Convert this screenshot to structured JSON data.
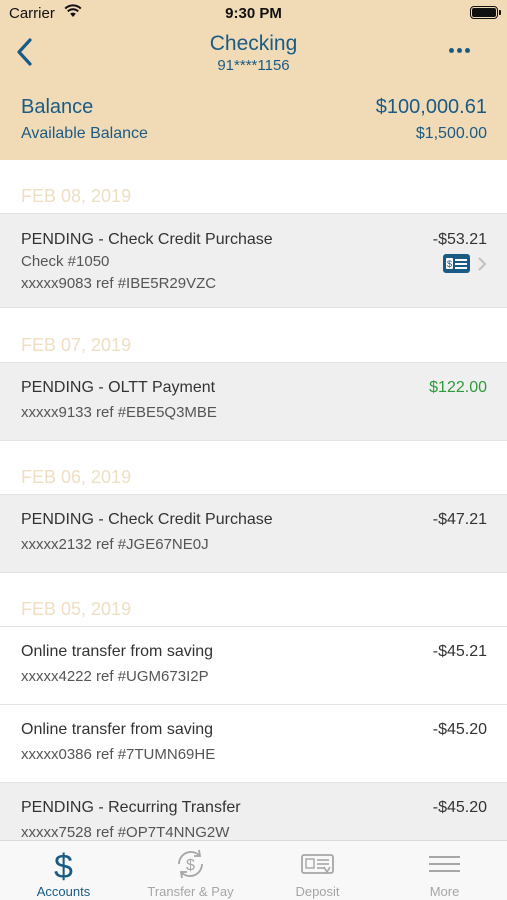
{
  "status_bar": {
    "carrier": "Carrier",
    "time": "9:30 PM"
  },
  "nav": {
    "title": "Checking",
    "subtitle": "91****1156",
    "back_icon": "chevron-left-icon",
    "more_icon": "ellipsis-icon"
  },
  "balance": {
    "label": "Balance",
    "value": "$100,000.61",
    "available_label": "Available Balance",
    "available_value": "$1,500.00"
  },
  "groups": [
    {
      "date": "FEB 08, 2019"
    },
    {
      "date": "FEB 07, 2019"
    },
    {
      "date": "FEB 06, 2019"
    },
    {
      "date": "FEB 05, 2019"
    }
  ],
  "transactions": [
    {
      "title": "PENDING - Check Credit Purchase",
      "amount": "-$53.21",
      "line2": "Check #1050",
      "line3": "xxxxx9083 ref #IBE5R29VZC"
    },
    {
      "title": "PENDING - OLTT Payment",
      "amount": "$122.00",
      "line2": "xxxxx9133 ref #EBE5Q3MBE"
    },
    {
      "title": "PENDING - Check Credit Purchase",
      "amount": "-$47.21",
      "line2": "xxxxx2132 ref #JGE67NE0J"
    },
    {
      "title": "Online transfer from saving",
      "amount": "-$45.21",
      "line2": "xxxxx4222 ref #UGM673I2P"
    },
    {
      "title": "Online transfer from saving",
      "amount": "-$45.20",
      "line2": "xxxxx0386 ref #7TUMN69HE"
    },
    {
      "title": "PENDING - Recurring Transfer",
      "amount": "-$45.20",
      "line2": "xxxxx7528 ref #OP7T4NNG2W"
    }
  ],
  "tabs": [
    {
      "label": "Accounts",
      "icon": "dollar-icon",
      "active": true
    },
    {
      "label": "Transfer & Pay",
      "icon": "transfer-icon",
      "active": false
    },
    {
      "label": "Deposit",
      "icon": "deposit-check-icon",
      "active": false
    },
    {
      "label": "More",
      "icon": "menu-icon",
      "active": false
    }
  ],
  "colors": {
    "header_bg": "#f1dbb6",
    "brand": "#1a5b86",
    "positive": "#2f9a3a",
    "date_text": "#eedfc3",
    "pending_bg": "#efefef"
  }
}
